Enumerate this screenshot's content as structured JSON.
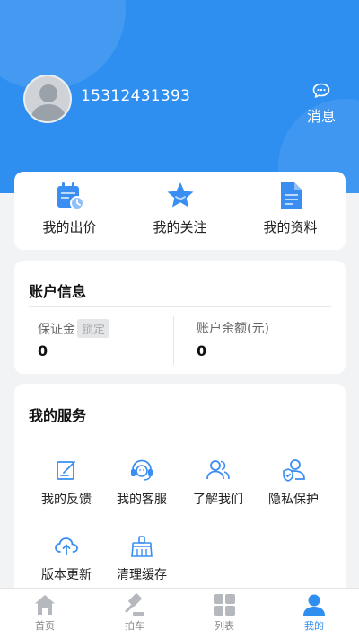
{
  "user": {
    "phone": "15312431393"
  },
  "message": {
    "label": "消息"
  },
  "quick_actions": [
    {
      "label": "我的出价",
      "icon": "calendar-bid-icon"
    },
    {
      "label": "我的关注",
      "icon": "star-icon"
    },
    {
      "label": "我的资料",
      "icon": "document-icon"
    }
  ],
  "account": {
    "title": "账户信息",
    "deposit_label": "保证金",
    "deposit_badge": "锁定",
    "deposit_value": "0",
    "balance_label": "账户余额(元)",
    "balance_value": "0"
  },
  "services": {
    "title": "我的服务",
    "items": [
      {
        "label": "我的反馈",
        "icon": "feedback-edit-icon"
      },
      {
        "label": "我的客服",
        "icon": "headset-icon"
      },
      {
        "label": "了解我们",
        "icon": "people-icon"
      },
      {
        "label": "隐私保护",
        "icon": "user-shield-icon"
      },
      {
        "label": "版本更新",
        "icon": "cloud-upload-icon"
      },
      {
        "label": "清理缓存",
        "icon": "broom-icon"
      }
    ]
  },
  "tabs": [
    {
      "label": "首页",
      "icon": "home-icon",
      "active": false
    },
    {
      "label": "拍车",
      "icon": "gavel-icon",
      "active": false
    },
    {
      "label": "列表",
      "icon": "grid-icon",
      "active": false
    },
    {
      "label": "我的",
      "icon": "person-icon",
      "active": true
    }
  ],
  "colors": {
    "primary": "#2f8ff0",
    "background": "#f2f3f5",
    "inactive_tab": "#b5b8bd"
  }
}
